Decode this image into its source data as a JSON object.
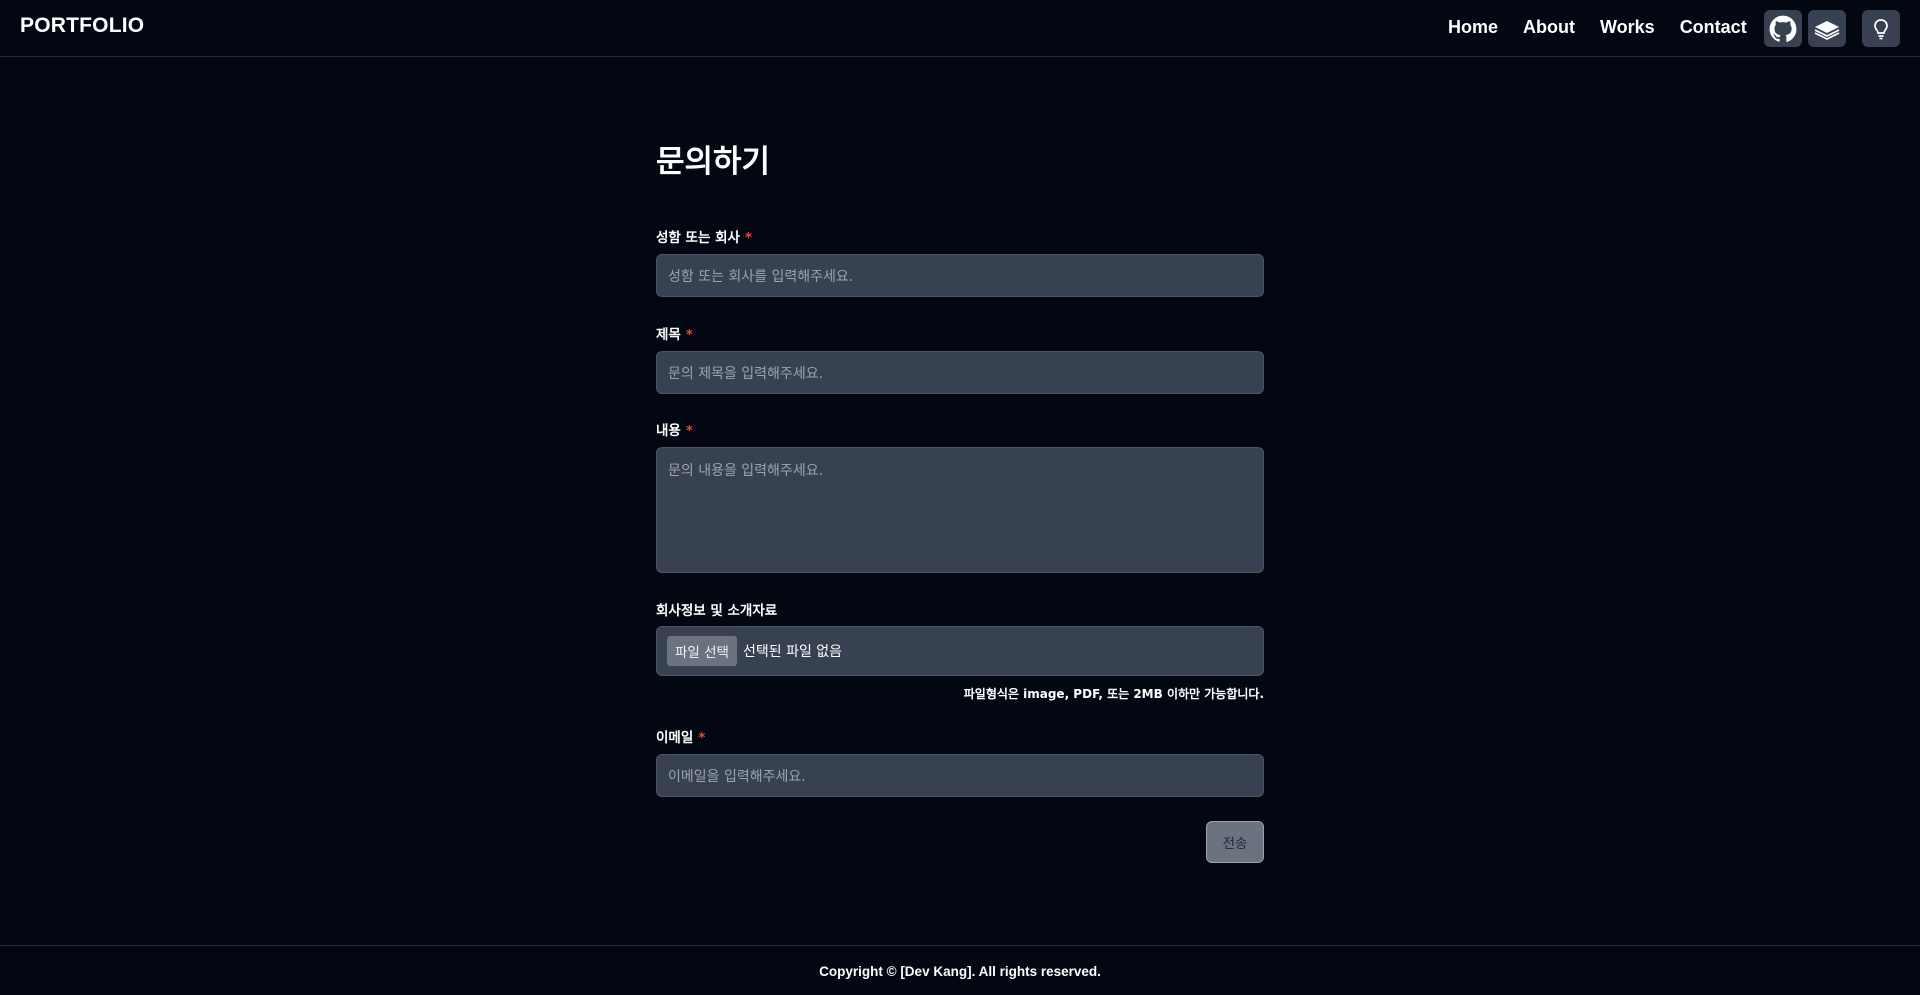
{
  "header": {
    "logo": "PORTFOLIO",
    "nav": [
      "Home",
      "About",
      "Works",
      "Contact"
    ],
    "icons": [
      "github-icon",
      "books-icon",
      "lightbulb-icon"
    ]
  },
  "form": {
    "title": "문의하기",
    "name_label": "성함 또는 회사",
    "name_placeholder": "성함 또는 회사를 입력해주세요.",
    "subject_label": "제목",
    "subject_placeholder": "문의 제목을 입력해주세요.",
    "content_label": "내용",
    "content_placeholder": "문의 내용을 입력해주세요.",
    "file_label": "회사정보 및 소개자료",
    "file_button": "파일 선택",
    "file_status": "선택된 파일 없음",
    "file_hint": "파일형식은 image, PDF, 또는 2MB 이하만 가능합니다.",
    "email_label": "이메일",
    "email_placeholder": "이메일을 입력해주세요.",
    "required_mark": "*",
    "submit": "전송"
  },
  "footer": {
    "copyright": "Copyright © [Dev Kang]. All rights reserved."
  },
  "colors": {
    "background": "#030712",
    "input": "#374151",
    "required": "#ef4444"
  }
}
